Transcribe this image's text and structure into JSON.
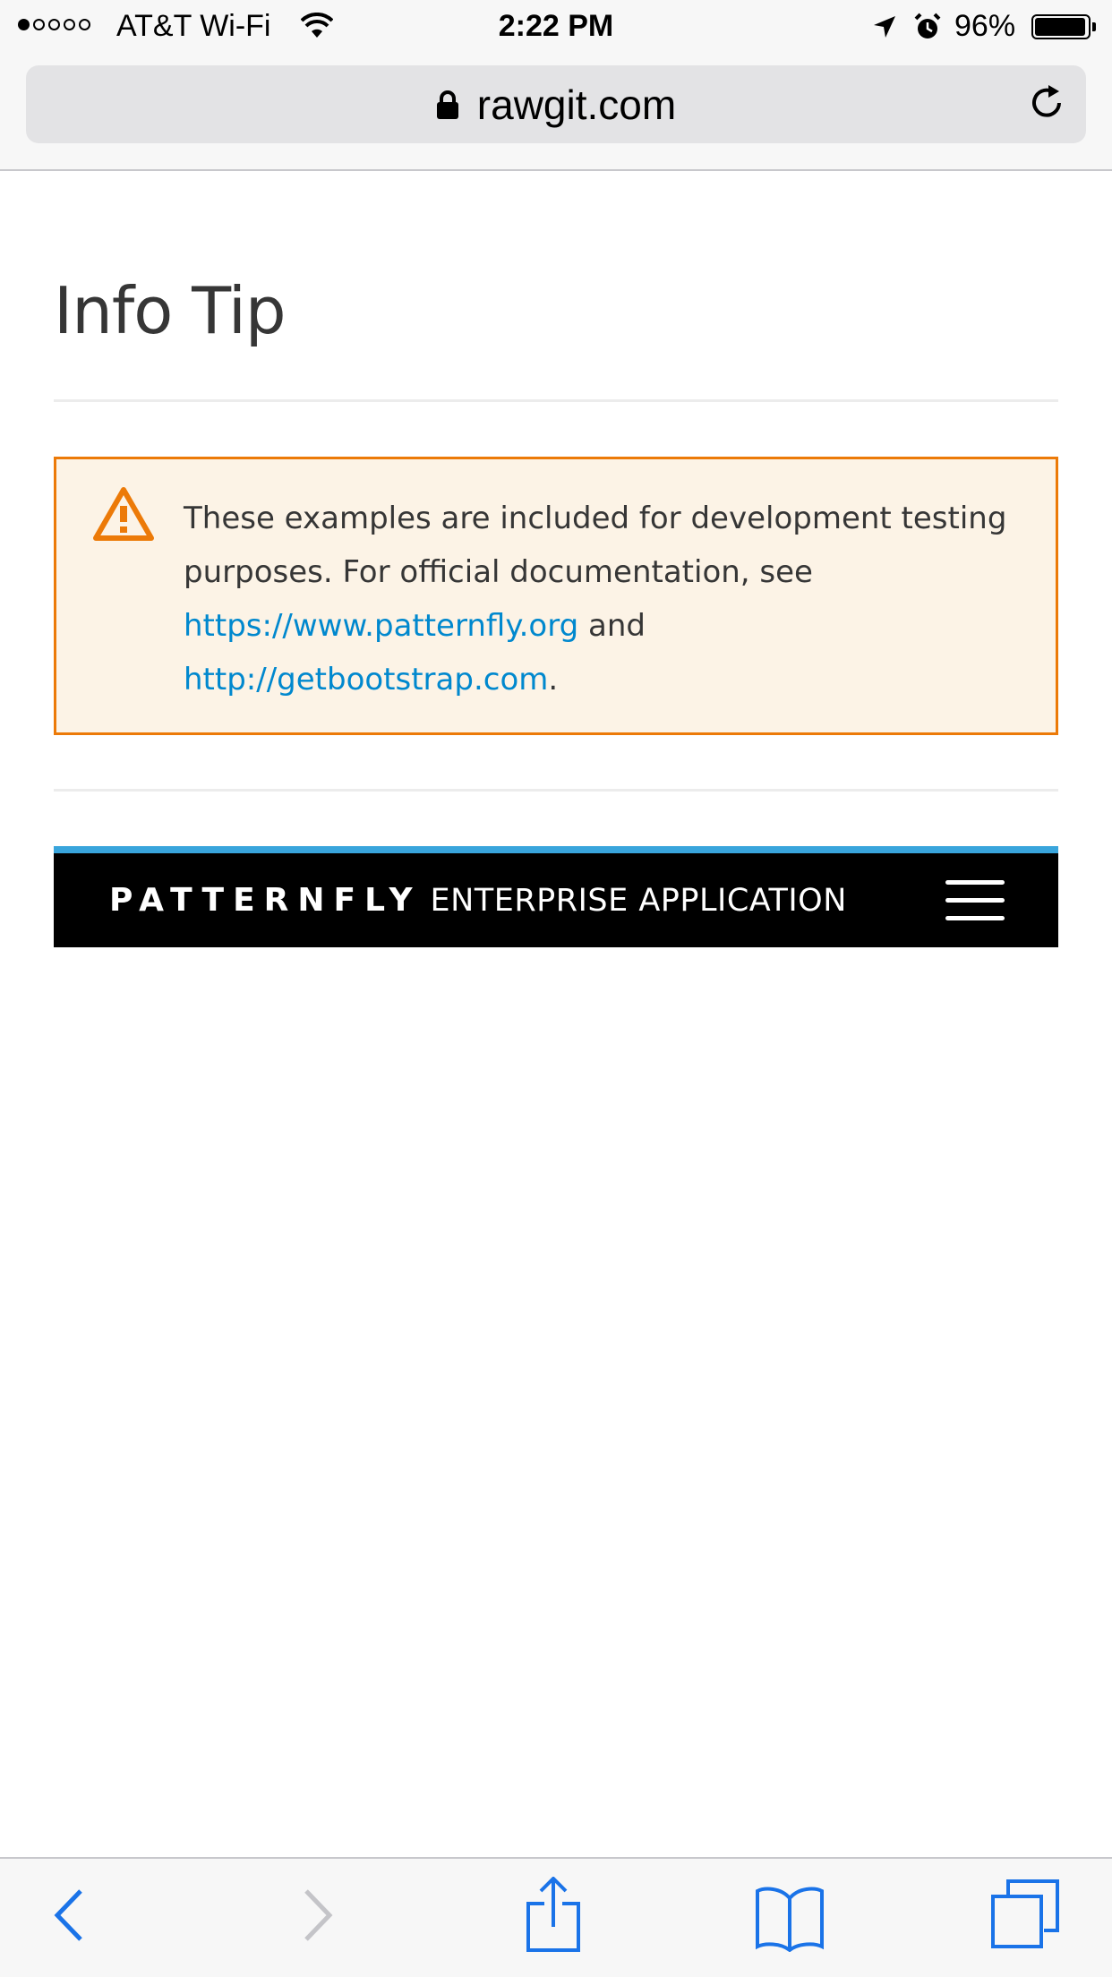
{
  "status_bar": {
    "carrier": "AT&T Wi-Fi",
    "time": "2:22 PM",
    "battery": "96%",
    "battery_level": 0.96,
    "signal_bars_filled": 1,
    "signal_bars_total": 5,
    "icons": [
      "signal-dots",
      "wifi-icon",
      "location-arrow-icon",
      "alarm-icon",
      "battery-icon"
    ]
  },
  "browser": {
    "url": "rawgit.com",
    "url_icon": "lock-icon",
    "reload_icon": "reload-icon"
  },
  "page": {
    "title": "Info Tip",
    "alert": {
      "text_before": "These examples are included for development testing purposes. For official documentation, see ",
      "link1": "https://www.patternfly.org",
      "text_mid": " and ",
      "link2": "http://getbootstrap.com",
      "text_after": ".",
      "icon": "warning-triangle-icon"
    },
    "navbar": {
      "brand": "PATTERNFLY",
      "subtitle": "ENTERPRISE APPLICATION",
      "menu_icon": "hamburger-menu-icon"
    }
  },
  "toolbar": {
    "buttons": [
      "back",
      "forward",
      "share",
      "bookmarks",
      "tabs"
    ]
  },
  "colors": {
    "accent_link": "#0088ce",
    "alert_border": "#ec7a08",
    "alert_background": "#fcf3e6",
    "navbar_top_border": "#39a5dc",
    "safari_blue": "#1a73e8"
  }
}
